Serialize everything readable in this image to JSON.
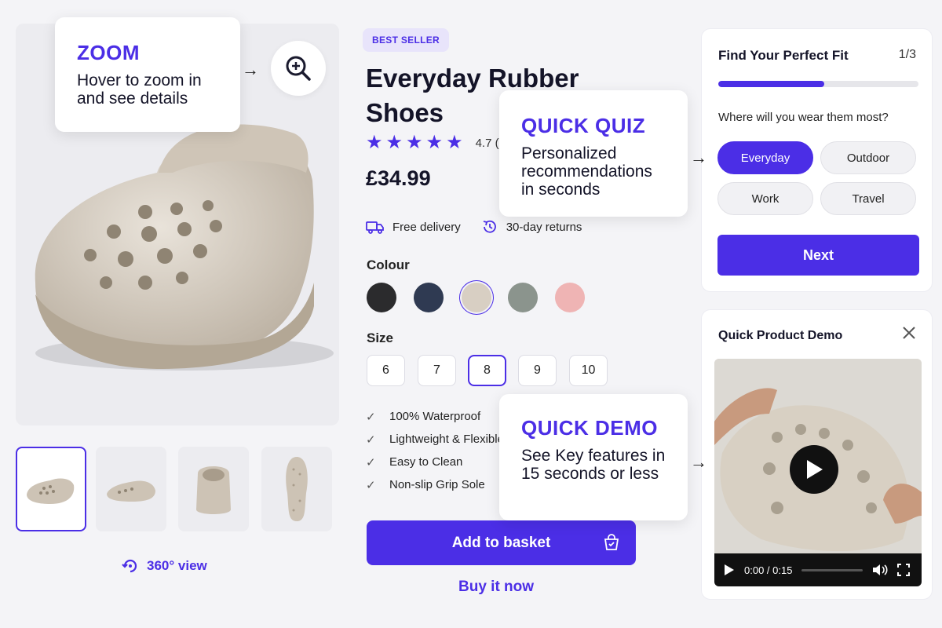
{
  "gallery": {
    "view360_label": "360° view"
  },
  "product": {
    "badge": "BEST SELLER",
    "title": "Everyday Rubber Shoes",
    "rating_value": "4.7 (",
    "rating_stars": 5,
    "price": "£34.99",
    "perks": [
      "Free delivery",
      "30-day returns"
    ],
    "colour_label": "Colour",
    "colours": [
      "#2b2b2d",
      "#2f3a52",
      "#d8cfc3",
      "#8b948d",
      "#efb4b4"
    ],
    "selected_colour": 2,
    "size_label": "Size",
    "sizes": [
      "6",
      "7",
      "8",
      "9",
      "10"
    ],
    "selected_size": "8",
    "features": [
      "100% Waterproof",
      "Lightweight & Flexible",
      "Easy to Clean",
      "Non-slip Grip Sole"
    ],
    "add_to_basket": "Add to basket",
    "buy_now": "Buy it now"
  },
  "quiz": {
    "title": "Find Your Perfect Fit",
    "step": "1/3",
    "progress": 0.53,
    "question": "Where will you wear them most?",
    "options": [
      "Everyday",
      "Outdoor",
      "Work",
      "Travel"
    ],
    "selected": "Everyday",
    "next_label": "Next"
  },
  "demo": {
    "title": "Quick Product Demo",
    "time": "0:00 / 0:15"
  },
  "callouts": {
    "zoom": {
      "heading": "ZOOM",
      "text": "Hover to zoom in and see details"
    },
    "quiz": {
      "heading": "QUICK QUIZ",
      "text": "Personalized recommendations in seconds"
    },
    "demo": {
      "heading": "QUICK DEMO",
      "text": "See Key features in 15 seconds or less"
    }
  },
  "accent_color": "#4b2ee6"
}
